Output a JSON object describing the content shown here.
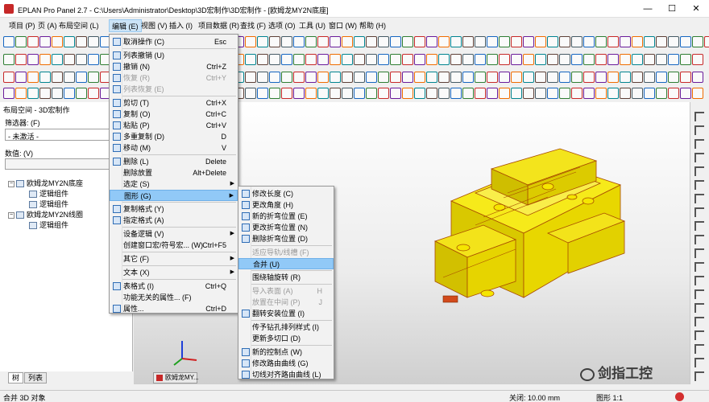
{
  "window": {
    "title": "EPLAN Pro Panel 2.7 - C:\\Users\\Administrator\\Desktop\\3D宏制作\\3D宏制作 - [欧姆龙MY2N底座]",
    "minimize": "—",
    "maximize": "☐",
    "close": "✕"
  },
  "menubar": [
    "项目 (P)",
    "页 (A)",
    "布局空间 (L)",
    "编辑 (E)",
    "视图 (V)",
    "插入 (I)",
    "项目数据 (R)",
    "查找 (F)",
    "选项 (O)",
    "工具 (U)",
    "窗口 (W)",
    "帮助 (H)"
  ],
  "left_panel": {
    "title": "布局空间 - 3D宏制作",
    "filter_label": "筛选器: (F)",
    "filter_value": "- 未激活 -",
    "count_label": "数值: (V)",
    "tree": [
      {
        "label": "欧姆龙MY2N底座",
        "level": 0
      },
      {
        "label": "逻辑组件",
        "level": 1
      },
      {
        "label": "逻辑组件",
        "level": 1
      },
      {
        "label": "欧姆龙MY2N线圈",
        "level": 0
      },
      {
        "label": "逻辑组件",
        "level": 1
      }
    ],
    "tabs": [
      "树",
      "列表"
    ]
  },
  "edit_menu": {
    "items": [
      {
        "label": "取消操作 (C)",
        "shortcut": "Esc",
        "icon": "cancel-icon"
      },
      {
        "sep": true
      },
      {
        "label": "列表撤销 (U)",
        "shortcut": "",
        "icon": "undo-list-icon"
      },
      {
        "label": "撤销 (N)",
        "shortcut": "Ctrl+Z",
        "icon": "undo-icon"
      },
      {
        "label": "恢复 (R)",
        "shortcut": "Ctrl+Y",
        "icon": "redo-icon",
        "disabled": true
      },
      {
        "label": "列表恢复 (E)",
        "shortcut": "",
        "icon": "redo-list-icon",
        "disabled": true
      },
      {
        "sep": true
      },
      {
        "label": "剪切 (T)",
        "shortcut": "Ctrl+X",
        "icon": "cut-icon"
      },
      {
        "label": "复制 (O)",
        "shortcut": "Ctrl+C",
        "icon": "copy-icon"
      },
      {
        "label": "粘贴 (P)",
        "shortcut": "Ctrl+V",
        "icon": "paste-icon"
      },
      {
        "label": "多重复制 (D)",
        "shortcut": "D",
        "icon": "multi-copy-icon"
      },
      {
        "label": "移动 (M)",
        "shortcut": "V",
        "icon": "move-icon"
      },
      {
        "sep": true
      },
      {
        "label": "删除 (L)",
        "shortcut": "Delete",
        "icon": "delete-icon"
      },
      {
        "label": "删除放置",
        "shortcut": "Alt+Delete",
        "icon": ""
      },
      {
        "label": "选定 (S)",
        "shortcut": "",
        "icon": "",
        "sub": true
      },
      {
        "label": "图形 (G)",
        "shortcut": "",
        "icon": "",
        "sub": true,
        "highlight": true
      },
      {
        "sep": true
      },
      {
        "label": "复制格式 (Y)",
        "shortcut": "",
        "icon": "format-copy-icon"
      },
      {
        "label": "指定格式 (A)",
        "shortcut": "",
        "icon": "format-assign-icon"
      },
      {
        "sep": true
      },
      {
        "label": "设备逻辑 (V)",
        "shortcut": "",
        "icon": "",
        "sub": true
      },
      {
        "label": "创建窗口宏/符号宏... (W)",
        "shortcut": "Ctrl+F5",
        "icon": ""
      },
      {
        "sep": true
      },
      {
        "label": "其它 (F)",
        "shortcut": "",
        "icon": "",
        "sub": true
      },
      {
        "sep": true
      },
      {
        "label": "文本 (X)",
        "shortcut": "",
        "icon": "",
        "sub": true
      },
      {
        "sep": true
      },
      {
        "label": "表格式 (I)",
        "shortcut": "Ctrl+Q",
        "icon": "table-icon"
      },
      {
        "label": "功能无关的属性... (F)",
        "shortcut": "",
        "icon": ""
      },
      {
        "label": "属性...",
        "shortcut": "Ctrl+D",
        "icon": "properties-icon"
      }
    ]
  },
  "graphics_submenu": {
    "items": [
      {
        "label": "修改长度 (C)",
        "shortcut": "",
        "icon": "length-icon"
      },
      {
        "label": "更改角度 (H)",
        "shortcut": "",
        "icon": "angle-icon"
      },
      {
        "label": "新的折弯位置 (E)",
        "shortcut": "",
        "icon": "bend-new-icon"
      },
      {
        "label": "更改折弯位置 (N)",
        "shortcut": "",
        "icon": "bend-change-icon"
      },
      {
        "label": "删除折弯位置 (D)",
        "shortcut": "",
        "icon": "bend-delete-icon"
      },
      {
        "sep": true
      },
      {
        "label": "适应导轨/线槽 (F)",
        "shortcut": "",
        "icon": "",
        "disabled": true
      },
      {
        "label": "合并 (U)",
        "shortcut": "",
        "icon": "",
        "highlight": true
      },
      {
        "sep": true
      },
      {
        "label": "围绕轴旋转 (R)",
        "shortcut": "",
        "icon": ""
      },
      {
        "sep": true
      },
      {
        "label": "导入表面 (A)",
        "shortcut": "H",
        "icon": "",
        "disabled": true
      },
      {
        "label": "放置在中间 (P)",
        "shortcut": "J",
        "icon": "",
        "disabled": true
      },
      {
        "label": "翻转安装位置 (I)",
        "shortcut": "",
        "icon": "flip-icon"
      },
      {
        "sep": true
      },
      {
        "label": "传予钻孔排列样式 (I)",
        "shortcut": "",
        "icon": ""
      },
      {
        "label": "更新多切口 (D)",
        "shortcut": "",
        "icon": ""
      },
      {
        "sep": true
      },
      {
        "label": "新的控制点 (W)",
        "shortcut": "",
        "icon": "control-point-icon"
      },
      {
        "label": "修改路由曲线 (G)",
        "shortcut": "",
        "icon": "route-curve-icon"
      },
      {
        "label": "切线对齐路由曲线 (L)",
        "shortcut": "",
        "icon": "tangent-icon"
      }
    ]
  },
  "doc_tab": "欧姆龙MY...",
  "watermark": "剑指工控",
  "statusbar": {
    "left": "合并 3D 对象",
    "grid": "关闭: 10.00 mm",
    "scale": "图形 1:1"
  }
}
